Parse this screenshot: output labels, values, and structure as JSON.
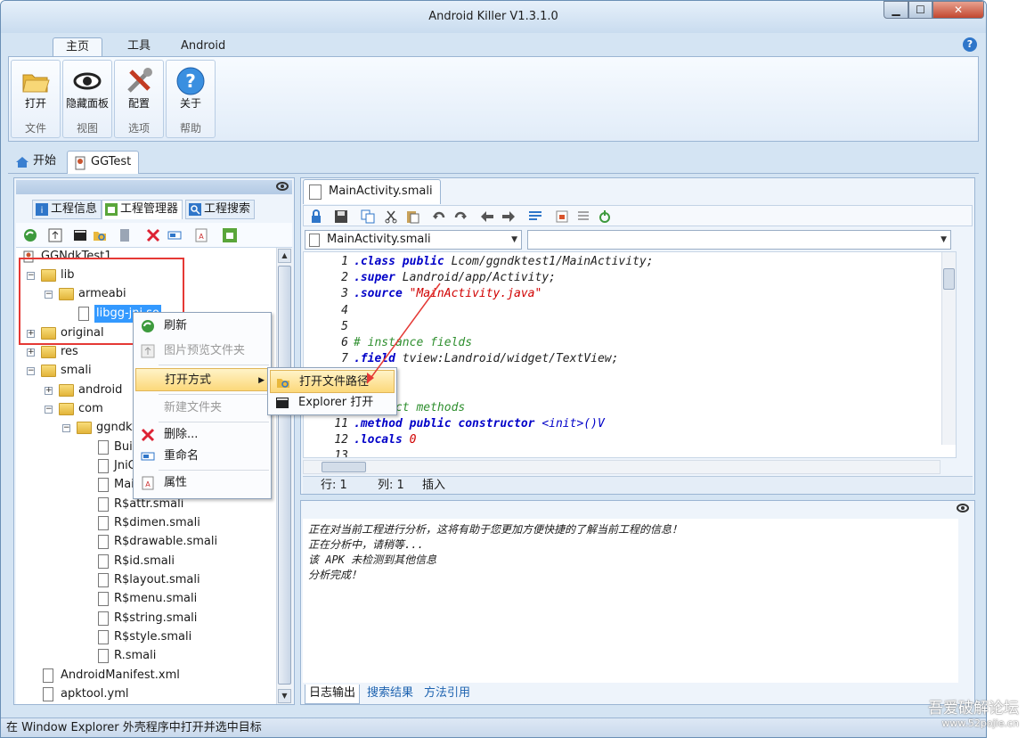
{
  "window": {
    "title": "Android Killer V1.3.1.0",
    "controls": {
      "minimize": "▁",
      "maximize": "☐",
      "close": "✕"
    }
  },
  "ribbon": {
    "tabs": [
      {
        "label": "主页"
      },
      {
        "label": "工具"
      },
      {
        "label": "Android"
      }
    ],
    "help": "?",
    "groups": [
      {
        "button": "打开",
        "group": "文件"
      },
      {
        "button": "隐藏面板",
        "group": "视图"
      },
      {
        "button": "配置",
        "group": "选项"
      },
      {
        "button": "关于",
        "group": "帮助"
      }
    ]
  },
  "doc_tabs": [
    {
      "label": "开始"
    },
    {
      "label": "GGTest"
    }
  ],
  "left_panel": {
    "tabs": [
      {
        "label": "工程信息"
      },
      {
        "label": "工程管理器"
      },
      {
        "label": "工程搜索"
      }
    ],
    "tree": [
      {
        "label": "GGNdkTest1"
      },
      {
        "label": "lib"
      },
      {
        "label": "armeabi"
      },
      {
        "label": "libgg-jni.so"
      },
      {
        "label": "original"
      },
      {
        "label": "res"
      },
      {
        "label": "smali"
      },
      {
        "label": "android"
      },
      {
        "label": "com"
      },
      {
        "label": "ggndktest1"
      },
      {
        "label": "BuildConfig.smali"
      },
      {
        "label": "JniGg.smali"
      },
      {
        "label": "MainActivity.smali"
      },
      {
        "label": "R$attr.smali"
      },
      {
        "label": "R$dimen.smali"
      },
      {
        "label": "R$drawable.smali"
      },
      {
        "label": "R$id.smali"
      },
      {
        "label": "R$layout.smali"
      },
      {
        "label": "R$menu.smali"
      },
      {
        "label": "R$string.smali"
      },
      {
        "label": "R$style.smali"
      },
      {
        "label": "R.smali"
      },
      {
        "label": "AndroidManifest.xml"
      },
      {
        "label": "apktool.yml"
      }
    ]
  },
  "context_menu": {
    "items": [
      {
        "label": "刷新"
      },
      {
        "label": "图片预览文件夹"
      },
      {
        "label": "打开方式"
      },
      {
        "label": "新建文件夹"
      },
      {
        "label": "删除..."
      },
      {
        "label": "重命名"
      },
      {
        "label": "属性"
      }
    ],
    "submenu": [
      {
        "label": "打开文件路径"
      },
      {
        "label": "Explorer 打开"
      }
    ]
  },
  "editor": {
    "tab": "MainActivity.smali",
    "combo_left": "MainActivity.smali",
    "combo_right": "",
    "lines": [
      {
        "n": "1",
        "a": ".class public ",
        "b": "Lcom/ggndktest1/MainActivity;",
        "type": "class"
      },
      {
        "n": "2",
        "a": ".super ",
        "b": "Landroid/app/Activity;",
        "type": "class"
      },
      {
        "n": "3",
        "a": ".source ",
        "b": "\"MainActivity.java\"",
        "type": "source"
      },
      {
        "n": "4",
        "a": "",
        "b": "",
        "type": "blank"
      },
      {
        "n": "5",
        "a": "",
        "b": "",
        "type": "blank"
      },
      {
        "n": "6",
        "a": "# instance fields",
        "b": "",
        "type": "comment"
      },
      {
        "n": "7",
        "a": ".field ",
        "b": "tview:Landroid/widget/TextView;",
        "type": "field"
      },
      {
        "n": "8",
        "a": "",
        "b": "",
        "type": "blank"
      },
      {
        "n": "9",
        "a": "",
        "b": "",
        "type": "blank"
      },
      {
        "n": "10",
        "a": "# direct methods",
        "b": "",
        "type": "comment"
      },
      {
        "n": "11",
        "a": ".method public constructor ",
        "b": "<init>()V",
        "type": "method"
      },
      {
        "n": "12",
        "a": "    .locals ",
        "b": "0",
        "type": "locals"
      },
      {
        "n": "13",
        "a": "",
        "b": "",
        "type": "blank"
      }
    ],
    "status": {
      "row": "行: 1",
      "col": "列: 1",
      "mode": "插入"
    }
  },
  "log": {
    "lines": [
      "正在对当前工程进行分析，这将有助于您更加方便快捷的了解当前工程的信息！",
      "正在分析中，请稍等...",
      "该 APK 未检测到其他信息",
      "分析完成！"
    ],
    "tabs": [
      {
        "label": "日志输出"
      },
      {
        "label": "搜索结果"
      },
      {
        "label": "方法引用"
      }
    ]
  },
  "statusbar": {
    "text": "在 Window Explorer 外壳程序中打开并选中目标"
  },
  "watermark": {
    "line1": "吾爱破解论坛",
    "line2": "www.52pojie.cn"
  }
}
